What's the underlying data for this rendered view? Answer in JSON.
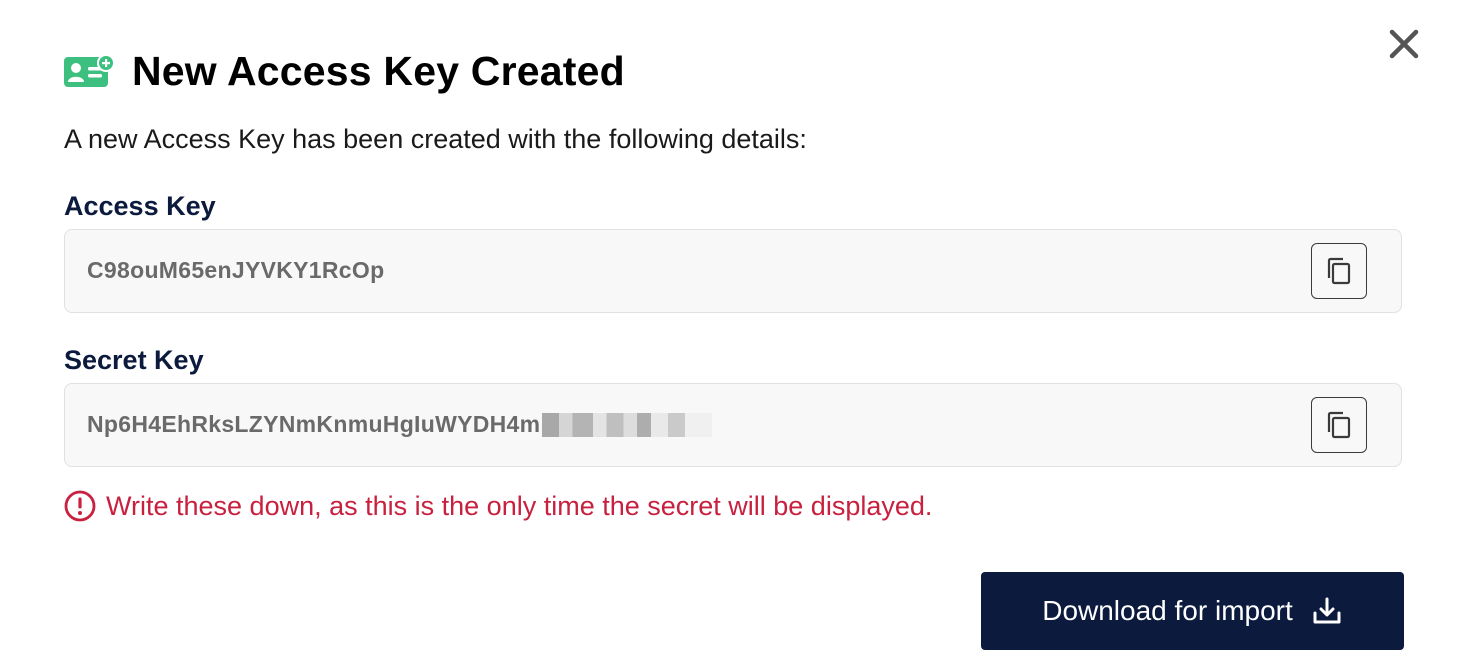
{
  "dialog": {
    "title": "New Access Key Created",
    "description": "A new Access Key has been created with the following details:",
    "header_icon": "id-card-add-icon",
    "accent_color": "#3dbf7f"
  },
  "fields": {
    "access_key": {
      "label": "Access Key",
      "value": "C98ouM65enJYVKY1RcOp"
    },
    "secret_key": {
      "label": "Secret Key",
      "value_visible": "Np6H4EhRksLZYNmKnmuHgIuWYDH4m"
    }
  },
  "warning": {
    "text": "Write these down, as this is the only time the secret will be displayed.",
    "color": "#c8203f",
    "icon": "exclamation-circle-icon"
  },
  "actions": {
    "download_label": "Download for import",
    "download_icon": "download-icon",
    "close_icon": "close-icon",
    "copy_icon": "copy-icon",
    "primary_color": "#0b1a3d"
  }
}
